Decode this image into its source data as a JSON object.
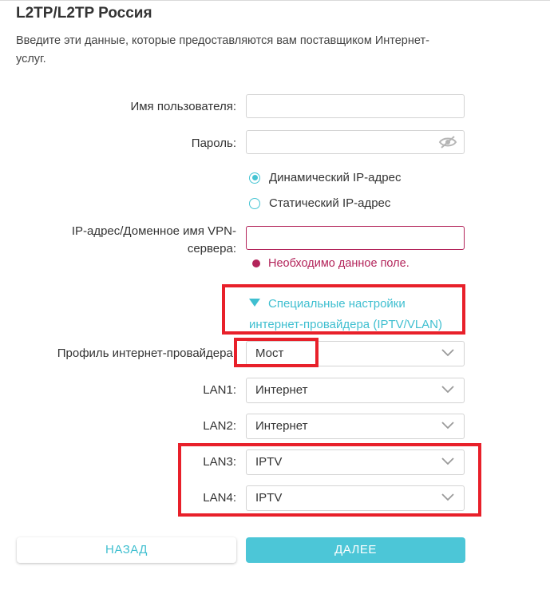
{
  "header": {
    "title": "L2TP/L2TP Россия",
    "description": "Введите эти данные, которые предоставляются вам поставщиком Интернет-услуг."
  },
  "form": {
    "username_label": "Имя пользователя:",
    "username_value": "",
    "password_label": "Пароль:",
    "password_value": "",
    "ip_mode": {
      "options": [
        "Динамический IP-адрес",
        "Статический IP-адрес"
      ],
      "selected": "Динамический IP-адрес"
    },
    "vpn_server_label": "IP-адрес/Доменное имя VPN-сервера:",
    "vpn_server_value": "",
    "vpn_server_error": "Необходимо данное поле."
  },
  "advanced": {
    "toggle_label": "Специальные настройки интернет-провайдера (IPTV/VLAN)",
    "isp_profile_label": "Профиль интернет-провайдера:",
    "isp_profile_value": "Мост",
    "lan1_label": "LAN1:",
    "lan1_value": "Интернет",
    "lan2_label": "LAN2:",
    "lan2_value": "Интернет",
    "lan3_label": "LAN3:",
    "lan3_value": "IPTV",
    "lan4_label": "LAN4:",
    "lan4_value": "IPTV"
  },
  "buttons": {
    "back": "НАЗАД",
    "next": "ДАЛЕЕ"
  },
  "colors": {
    "accent": "#4cc6d7",
    "error": "#b3245a",
    "highlight": "#e8202a"
  }
}
